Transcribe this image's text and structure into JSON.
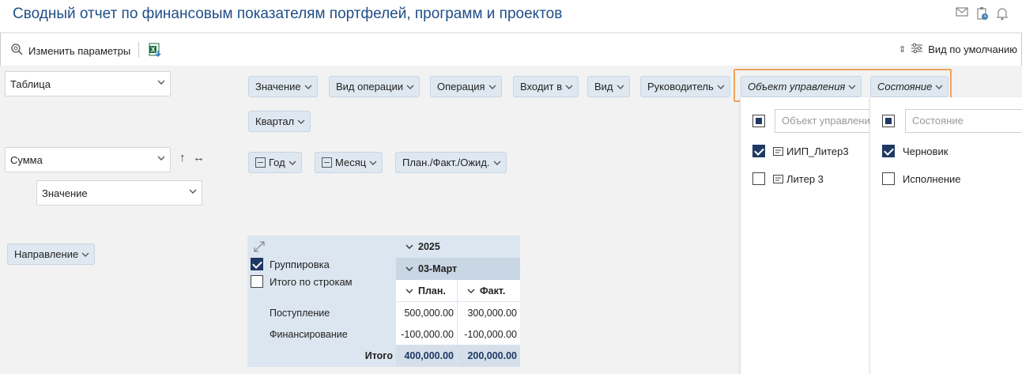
{
  "header": {
    "title": "Сводный отчет по финансовым показателям портфелей, программ и проектов",
    "icons": [
      "mail-icon",
      "clipboard-clock-icon",
      "bell-icon"
    ]
  },
  "toolbar": {
    "change_params": "Изменить параметры",
    "default_view": "Вид по умолчанию"
  },
  "left": {
    "view_select": "Таблица",
    "agg_select": "Сумма",
    "measure_select": "Значение",
    "direction_chip": "Направление"
  },
  "filters": {
    "row1": [
      "Значение",
      "Вид операции",
      "Операция",
      "Входит в",
      "Вид",
      "Руководитель",
      "Объект управления",
      "Состояние"
    ],
    "row2": [
      "Квартал"
    ],
    "columns": [
      "Год",
      "Месяц",
      "План./Факт./Ожид."
    ]
  },
  "panels": {
    "object": {
      "placeholder": "Объект управлени",
      "items": [
        {
          "label": "ИИП_Литер3",
          "checked": true
        },
        {
          "label": "Литер 3",
          "checked": false
        }
      ]
    },
    "state": {
      "placeholder": "Состояние",
      "items": [
        {
          "label": "Черновик",
          "checked": true
        },
        {
          "label": "Исполнение",
          "checked": false
        }
      ]
    }
  },
  "pivot": {
    "grouping_label": "Группировка",
    "grouping_checked": true,
    "totals_label": "Итого по строкам",
    "totals_checked": false,
    "year": "2025",
    "month": "03-Март",
    "col_plan": "План.",
    "col_fact": "Факт.",
    "rows": [
      {
        "label": "Поступление",
        "plan": "500,000.00",
        "fact": "300,000.00"
      },
      {
        "label": "Финансирование",
        "plan": "-100,000.00",
        "fact": "-100,000.00"
      }
    ],
    "total": {
      "label": "Итого",
      "plan": "400,000.00",
      "fact": "200,000.00"
    }
  }
}
